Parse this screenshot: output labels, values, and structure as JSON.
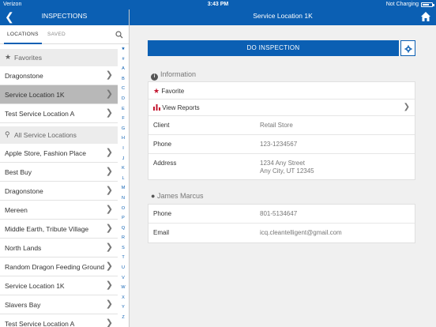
{
  "status_bar": {
    "carrier": "Verizon",
    "time": "3:43 PM",
    "charging": "Not Charging",
    "battery_level": 0.7
  },
  "left_nav": {
    "title": "INSPECTIONS"
  },
  "right_nav": {
    "title": "Service Location 1K"
  },
  "tabs": {
    "locations": "LOCATIONS",
    "saved": "SAVED"
  },
  "favorites": {
    "title": "Favorites",
    "items": [
      "Dragonstone",
      "Service Location 1K",
      "Test Service Location A"
    ],
    "selected": "Service Location 1K"
  },
  "all_locations": {
    "title": "All Service Locations",
    "items": [
      "Apple Store, Fashion Place",
      "Best Buy",
      "Dragonstone",
      "Mereen",
      "Middle Earth, Tribute Village",
      "North Lands",
      "Random Dragon Feeding Ground",
      "Service Location 1K",
      "Slavers Bay",
      "Test Service Location A"
    ]
  },
  "index_letters": [
    "★",
    "#",
    "A",
    "B",
    "C",
    "D",
    "E",
    "F",
    "G",
    "H",
    "I",
    "J",
    "K",
    "L",
    "M",
    "N",
    "O",
    "P",
    "Q",
    "R",
    "S",
    "T",
    "U",
    "V",
    "W",
    "X",
    "Y",
    "Z"
  ],
  "main": {
    "do_inspection": "DO INSPECTION",
    "information": {
      "heading": "Information",
      "favorite": "Favorite",
      "view_reports": "View Reports",
      "client_label": "Client",
      "client_value": "Retail Store",
      "phone_label": "Phone",
      "phone_value": "123-1234567",
      "address_label": "Address",
      "address_line1": "1234 Any Street",
      "address_line2": "Any City, UT 12345"
    },
    "contact": {
      "heading": "James Marcus",
      "phone_label": "Phone",
      "phone_value": "801-5134647",
      "email_label": "Email",
      "email_value": "icq.cleantelligent@gmail.com"
    }
  },
  "colors": {
    "primary": "#0b5fb3",
    "favorite_star": "#c3162f",
    "selected_row": "#b8b8b8"
  }
}
